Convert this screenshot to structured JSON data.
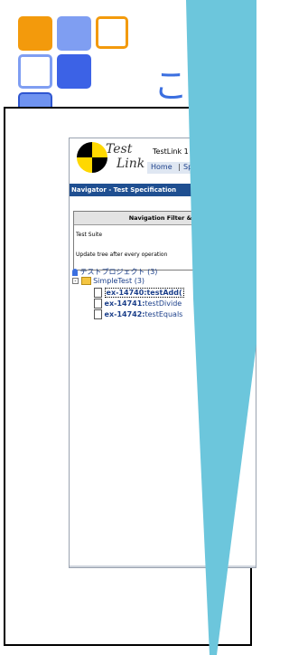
{
  "slide": {
    "title": "こ"
  },
  "colors": {
    "orange": "#f39a0c",
    "light_blue": "#7f9ef2",
    "dark_blue": "#3c62e6",
    "cyan_beam": "#6cc6dc"
  },
  "screenshot": {
    "app_title": "TestLink 1",
    "logo_word1": "Test",
    "logo_word2": "Link",
    "nav_links": [
      "Home",
      "Sp"
    ],
    "navigator_title": "Navigator - Test Specification",
    "filter": {
      "title": "Navigation Filter & S",
      "line1": "Test Suite",
      "line2": "Update tree after every operation"
    },
    "tree": {
      "project": "テストプロジェクト (3)",
      "suite": "SimpleTest (3)",
      "cases": [
        {
          "id": "ex-14740:",
          "name": "testAdd("
        },
        {
          "id": "ex-14741:",
          "name": "testDivide"
        },
        {
          "id": "ex-14742:",
          "name": "testEquals"
        }
      ],
      "trailing": "()"
    }
  }
}
